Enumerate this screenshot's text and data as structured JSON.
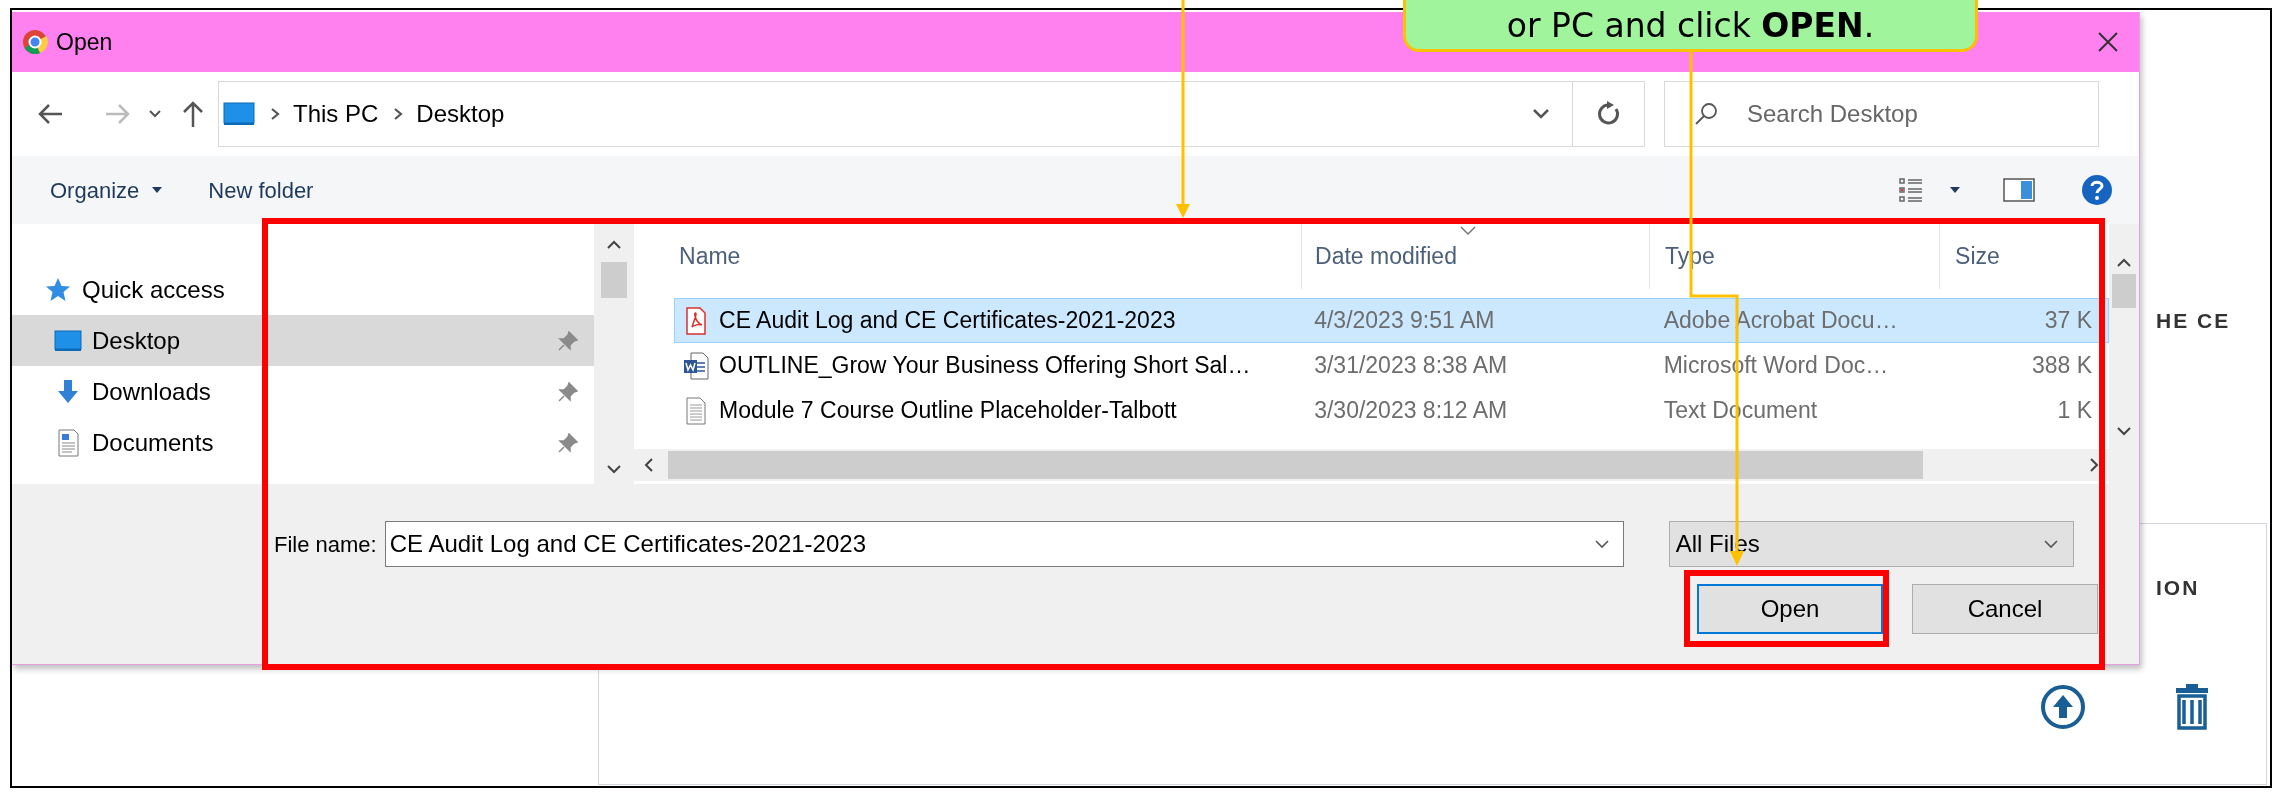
{
  "callout": {
    "text": "or PC and click **OPEN**."
  },
  "dialog": {
    "title": "Open",
    "breadcrumb": [
      "This PC",
      "Desktop"
    ],
    "search": {
      "placeholder": "Search Desktop"
    },
    "toolbar": [
      "Organize",
      "New folder"
    ],
    "nav": [
      {
        "label": "Quick access",
        "kind": "star",
        "selected": false,
        "pinned": false
      },
      {
        "label": "Desktop",
        "kind": "desktop",
        "selected": true,
        "pinned": true
      },
      {
        "label": "Downloads",
        "kind": "download",
        "selected": false,
        "pinned": true
      },
      {
        "label": "Documents",
        "kind": "document",
        "selected": false,
        "pinned": true
      }
    ],
    "columns": [
      "Name",
      "Date modified",
      "Type",
      "Size"
    ],
    "files": [
      {
        "kind": "pdf",
        "name": "CE Audit Log and CE Certificates-2021-2023",
        "date": "4/3/2023 9:51 AM",
        "type": "Adobe Acrobat Docu…",
        "size": "37 K",
        "selected": true
      },
      {
        "kind": "word",
        "name": "OUTLINE_Grow Your Business Offering Short Sal…",
        "date": "3/31/2023 8:38 AM",
        "type": "Microsoft Word Doc…",
        "size": "388 K",
        "selected": false
      },
      {
        "kind": "text",
        "name": "Module 7 Course Outline Placeholder-Talbott",
        "date": "3/30/2023 8:12 AM",
        "type": "Text Document",
        "size": "1 K",
        "selected": false
      }
    ],
    "file_name": {
      "label": "File name:",
      "value": "CE Audit Log and CE Certificates-2021-2023"
    },
    "file_type": "All Files",
    "buttons": [
      {
        "label": "Open",
        "default": true
      },
      {
        "label": "Cancel",
        "default": false
      }
    ]
  },
  "background": {
    "headings": [
      "HE CE",
      "ION"
    ]
  }
}
